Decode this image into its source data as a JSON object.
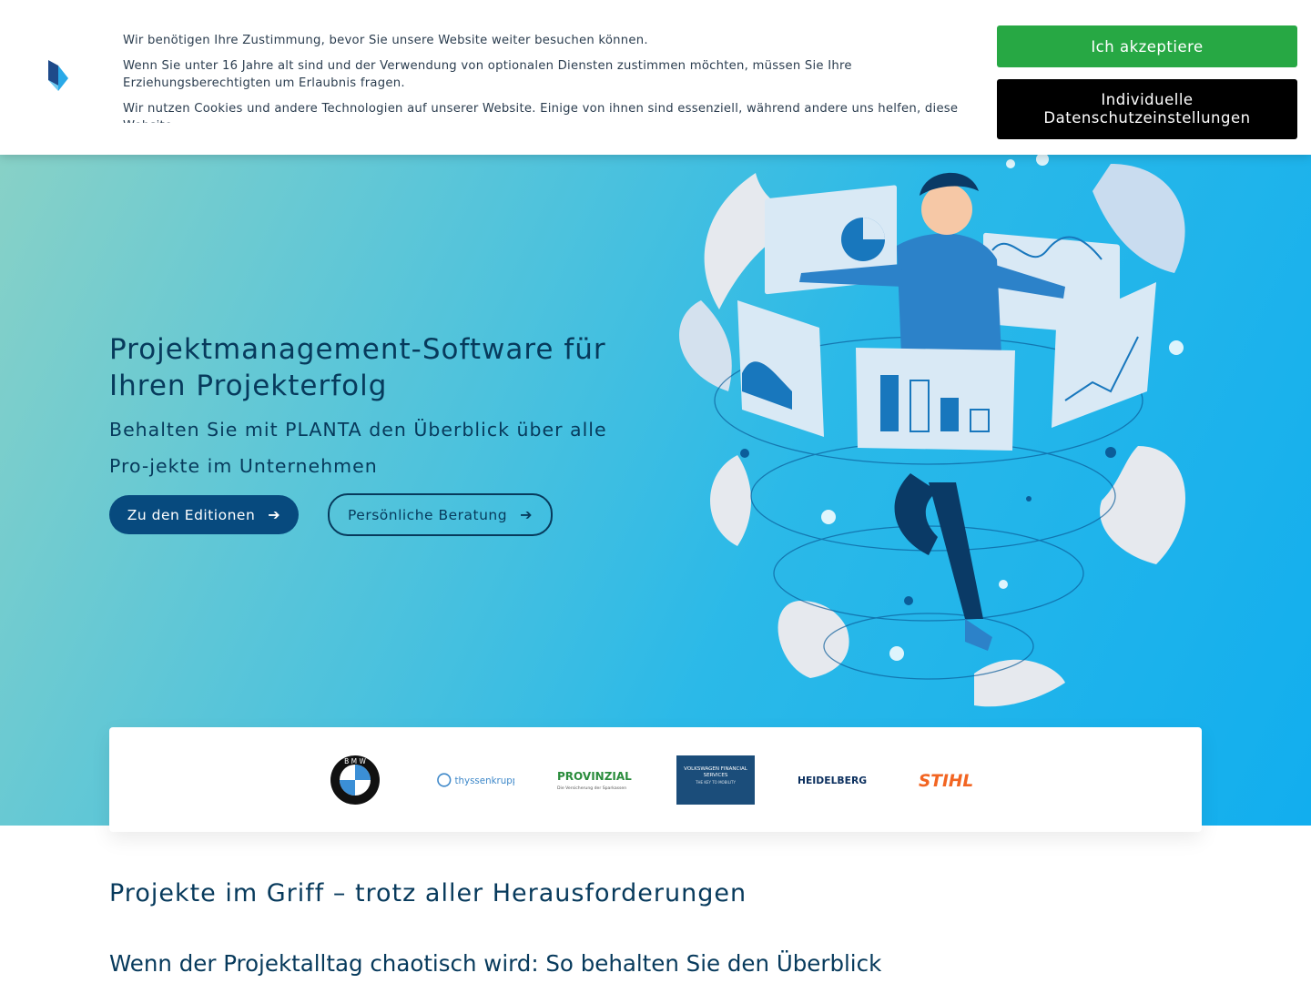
{
  "cookie_banner": {
    "paragraphs": [
      "Wir benötigen Ihre Zustimmung, bevor Sie unsere Website weiter besuchen können.",
      "Wenn Sie unter 16 Jahre alt sind und der Verwendung von optionalen Diensten zustimmen möchten, müssen Sie Ihre Erziehungsberechtigten um Erlaubnis fragen.",
      "Wir nutzen Cookies und andere Technologien auf unserer Website. Einige von ihnen sind essenziell, während andere uns helfen, diese Website"
    ],
    "accept_label": "Ich akzeptiere",
    "custom_label": "Individuelle Datenschutzeinstellungen",
    "accept_color": "#27a844",
    "logo_icon": "planta-logo-icon"
  },
  "hero": {
    "title": "Projektmanagement-Software für Ihren Projekterfolg",
    "subtitle": "Behalten Sie mit PLANTA den Überblick über alle Pro-jekte im Unternehmen",
    "primary_button": "Zu den Editionen",
    "secondary_button": "Persönliche Beratung",
    "arrow_icon": "arrow-right-icon",
    "brand_color": "#074a7e"
  },
  "customer_logos": [
    {
      "name": "BMW",
      "label": "B M W"
    },
    {
      "name": "thyssenkrupp",
      "label": "thyssenkrupp"
    },
    {
      "name": "Provinzial",
      "label": "PROVINZIAL",
      "tagline": "Die Versicherung der Sparkassen"
    },
    {
      "name": "Volkswagen Financial Services",
      "label": "VOLKSWAGEN FINANCIAL SERVICES",
      "tagline": "THE KEY TO MOBILITY"
    },
    {
      "name": "Heidelberg",
      "label": "HEIDELBERG"
    },
    {
      "name": "Stihl",
      "label": "STIHL"
    }
  ],
  "main": {
    "section_title": "Projekte im Griff – trotz aller Herausforderungen",
    "section_subtitle": "Wenn der Projektalltag chaotisch wird: So behalten Sie den Überblick"
  }
}
